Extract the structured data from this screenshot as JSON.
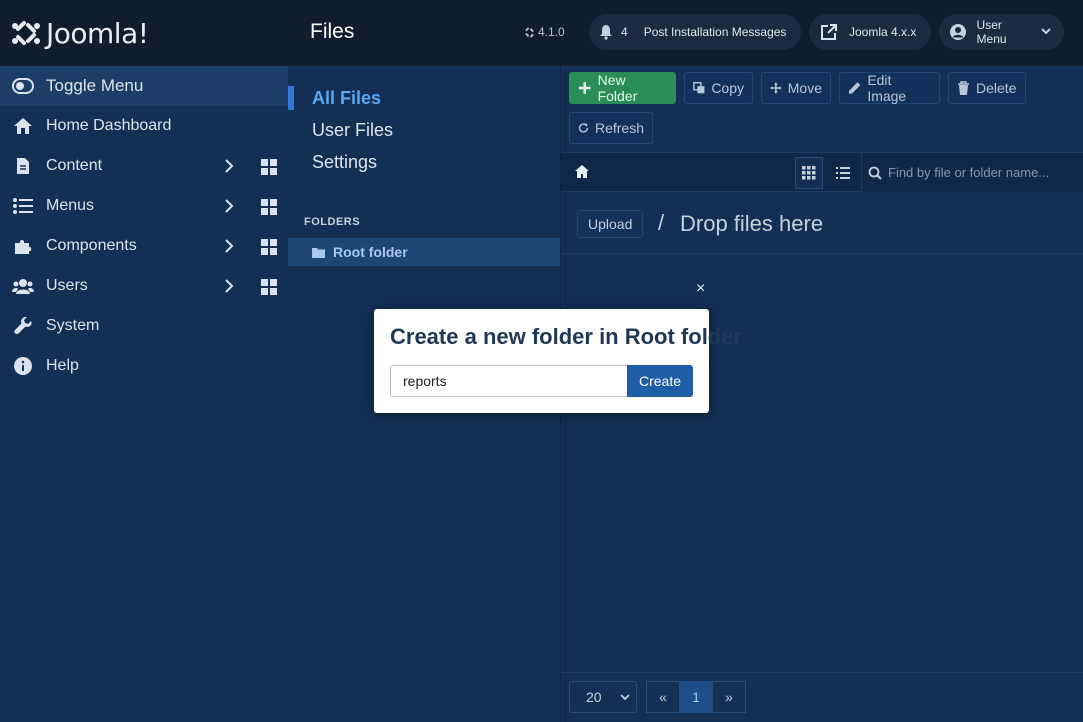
{
  "header": {
    "logo_text": "Joomla!",
    "page_title": "Files",
    "version": "4.1.0",
    "notifications_count": "4",
    "post_install_label": "Post Installation Messages",
    "site_label": "Joomla 4.x.x",
    "user_menu_label": "User Menu"
  },
  "sidebar": {
    "toggle_label": "Toggle Menu",
    "items": [
      {
        "label": "Home Dashboard",
        "icon": "home-icon"
      },
      {
        "label": "Content",
        "icon": "file-icon"
      },
      {
        "label": "Menus",
        "icon": "list-icon"
      },
      {
        "label": "Components",
        "icon": "puzzle-icon"
      },
      {
        "label": "Users",
        "icon": "users-icon"
      },
      {
        "label": "System",
        "icon": "wrench-icon"
      },
      {
        "label": "Help",
        "icon": "info-icon"
      }
    ]
  },
  "tree": {
    "nav": [
      "All Files",
      "User Files",
      "Settings"
    ],
    "folders_label": "FOLDERS",
    "root_folder": "Root folder"
  },
  "toolbar": {
    "new_folder": "New Folder",
    "copy": "Copy",
    "move": "Move",
    "edit_image": "Edit Image",
    "delete": "Delete",
    "refresh": "Refresh"
  },
  "browser": {
    "search_placeholder": "Find by file or folder name...",
    "upload_label": "Upload",
    "drop_slash": "/",
    "drop_text": "Drop files here"
  },
  "pager": {
    "limit": "20",
    "prev": "«",
    "current": "1",
    "next": "»"
  },
  "modal": {
    "close": "×",
    "title": "Create a new folder in Root folder",
    "input_value": "reports",
    "create_label": "Create"
  },
  "colors": {
    "sidebar_bg": "#132f53",
    "header_bg": "#101d2e",
    "primary_green": "#2a8d55",
    "accent_blue": "#1f5ea6"
  }
}
